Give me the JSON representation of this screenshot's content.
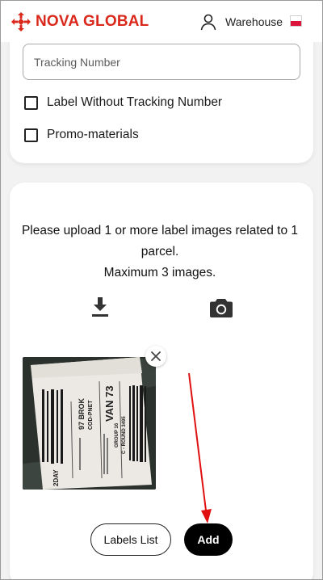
{
  "header": {
    "brand": "NOVA GLOBAL",
    "brand_color": "#da291c",
    "user_icon": "user-icon",
    "user_label": "Warehouse",
    "language_flag": "poland-flag-icon"
  },
  "form": {
    "tracking_placeholder": "Tracking Number",
    "tracking_value": "",
    "options": [
      {
        "label": "Label Without Tracking Number",
        "checked": false
      },
      {
        "label": "Promo-materials",
        "checked": false
      }
    ]
  },
  "upload": {
    "instructions_line1": "Please upload 1 or more label images related to 1 parcel.",
    "instructions_line2": "Maximum 3 images.",
    "upload_icon": "download-icon",
    "camera_icon": "camera-icon",
    "images": [
      {
        "name": "uploaded-label-photo",
        "visible_text": [
          "97 BROK",
          "COD-PNET",
          "VAN 73",
          "GROUP 16",
          "C - ROUND 3495",
          "2DAY"
        ]
      }
    ],
    "remove_icon": "close-icon"
  },
  "actions": {
    "labels_list": "Labels List",
    "add": "Add"
  },
  "annotation": {
    "arrow_color": "#e01010"
  }
}
